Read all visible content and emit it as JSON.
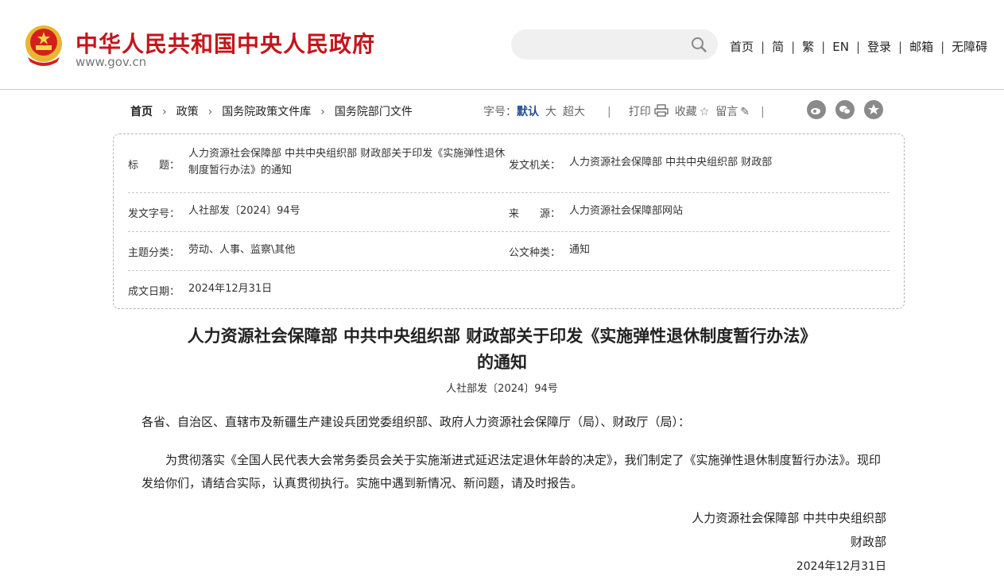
{
  "header": {
    "site_title": "中华人民共和国中央人民政府",
    "site_url": "www.gov.cn",
    "search": {
      "placeholder": ""
    },
    "nav": [
      "首页",
      "简",
      "繁",
      "EN",
      "登录",
      "邮箱",
      "无障碍"
    ],
    "nav_separator": "|"
  },
  "breadcrumb": {
    "items": [
      "首页",
      "政策",
      "国务院政策文件库",
      "国务院部门文件"
    ],
    "arrow": "›"
  },
  "tools": {
    "font_label": "字号：",
    "font_default": "默认",
    "font_large": "大",
    "font_xlarge": "超大",
    "print": "打印",
    "favorite": "收藏",
    "comment": "留言",
    "separator": "|"
  },
  "info": {
    "title_label": "标　　题：",
    "title_value": "人力资源社会保障部 中共中央组织部 财政部关于印发《实施弹性退休制度暂行办法》的通知",
    "issuer_label": "发文机关：",
    "issuer_value": "人力资源社会保障部 中共中央组织部 财政部",
    "docno_label": "发文字号：",
    "docno_value": "人社部发〔2024〕94号",
    "source_label": "来　　源：",
    "source_value": "人力资源社会保障部网站",
    "topic_label": "主题分类：",
    "topic_value": "劳动、人事、监察\\其他",
    "type_label": "公文种类：",
    "type_value": "通知",
    "date_label": "成文日期：",
    "date_value": "2024年12月31日"
  },
  "document": {
    "title_line1": "人力资源社会保障部  中共中央组织部  财政部关于印发《实施弹性退休制度暂行办法》",
    "title_line2": "的通知",
    "number": "人社部发〔2024〕94号",
    "addressee": "各省、自治区、直辖市及新疆生产建设兵团党委组织部、政府人力资源社会保障厅（局）、财政厅（局）：",
    "body": "为贯彻落实《全国人民代表大会常务委员会关于实施渐进式延迟法定退休年龄的决定》，我们制定了《实施弹性退休制度暂行办法》。现印发给你们，请结合实际，认真贯彻执行。实施中遇到新情况、新问题，请及时报告。",
    "signature_line1": "人力资源社会保障部  中共中央组织部",
    "signature_line2": "财政部",
    "signature_date": "2024年12月31日"
  },
  "colors": {
    "brand_red": "#c4161c",
    "accent_blue": "#1f4f94"
  }
}
